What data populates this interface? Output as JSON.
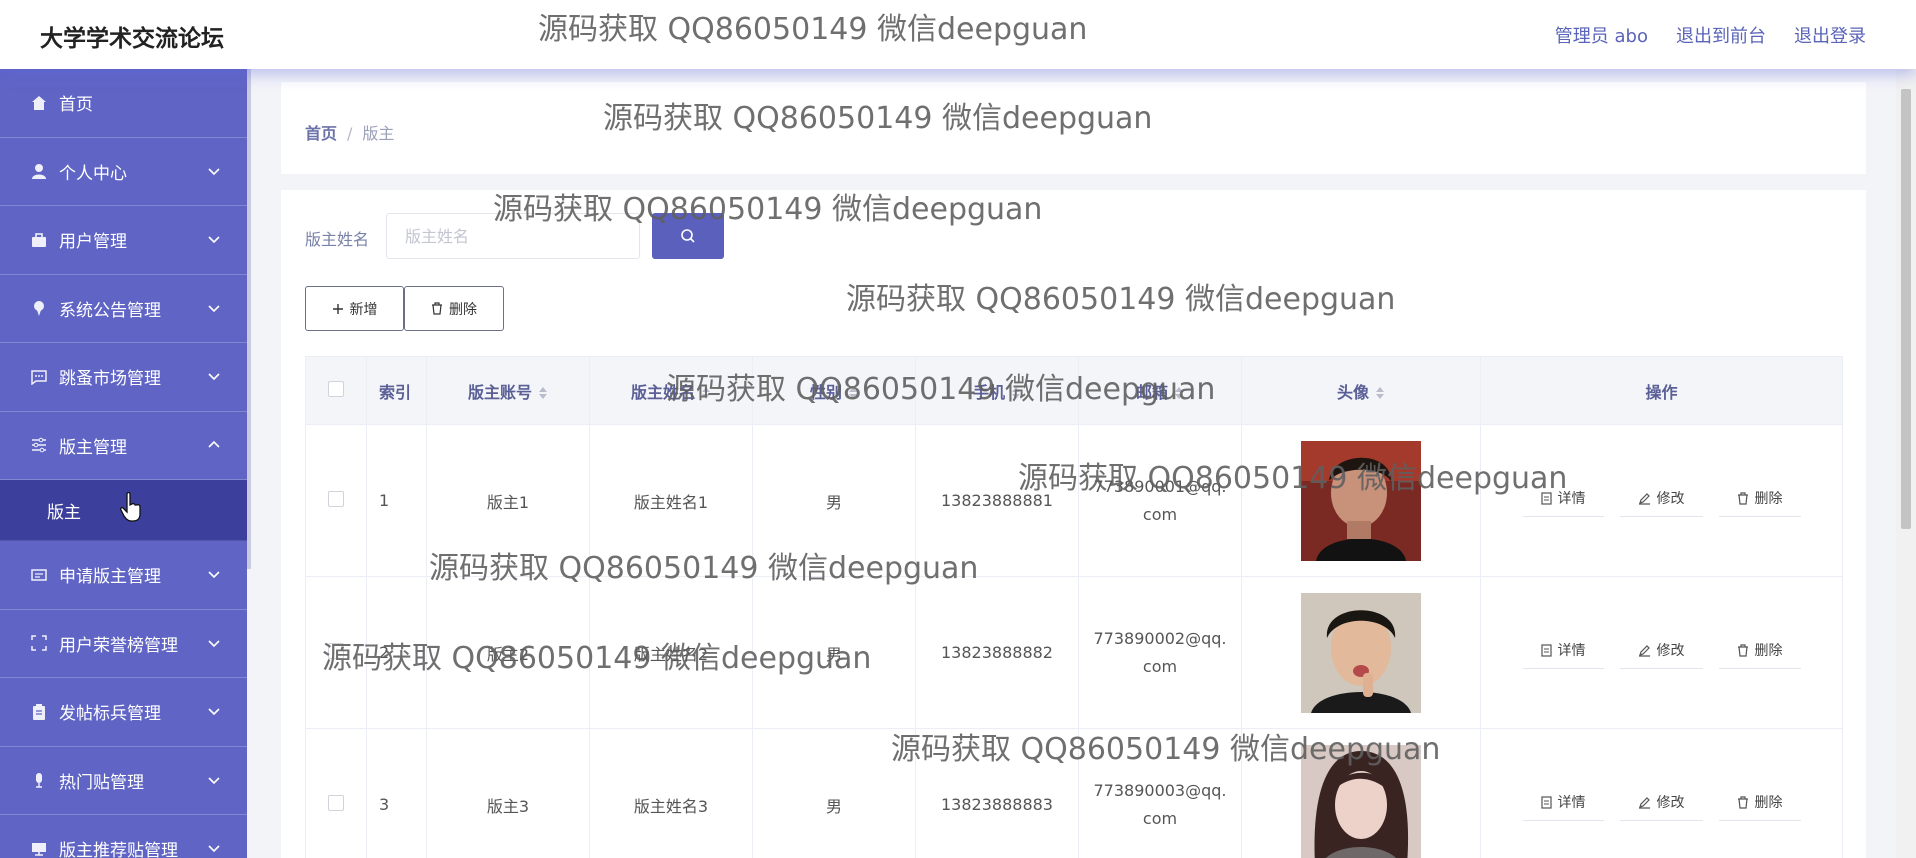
{
  "header": {
    "app_title": "大学学术交流论坛",
    "admin_label": "管理员 abo",
    "back_to_front": "退出到前台",
    "logout": "退出登录"
  },
  "sidebar": {
    "items": [
      {
        "label": "首页",
        "icon": "home-icon",
        "expandable": false
      },
      {
        "label": "个人中心",
        "icon": "user-icon",
        "expandable": true
      },
      {
        "label": "用户管理",
        "icon": "briefcase-icon",
        "expandable": true
      },
      {
        "label": "系统公告管理",
        "icon": "pin-icon",
        "expandable": true
      },
      {
        "label": "跳蚤市场管理",
        "icon": "chat-icon",
        "expandable": true
      },
      {
        "label": "版主管理",
        "icon": "sliders-icon",
        "expandable": true,
        "expanded": true
      },
      {
        "label": "申请版主管理",
        "icon": "card-icon",
        "expandable": true
      },
      {
        "label": "用户荣誉榜管理",
        "icon": "frame-icon",
        "expandable": true
      },
      {
        "label": "发帖标兵管理",
        "icon": "clipboard-icon",
        "expandable": true
      },
      {
        "label": "热门贴管理",
        "icon": "mic-icon",
        "expandable": true
      },
      {
        "label": "版主推荐贴管理",
        "icon": "monitor-icon",
        "expandable": true
      }
    ],
    "active_sub": "版主"
  },
  "breadcrumb": {
    "home": "首页",
    "current": "版主"
  },
  "search": {
    "label": "版主姓名",
    "placeholder": "版主姓名"
  },
  "toolbar": {
    "add_label": "新增",
    "delete_label": "删除"
  },
  "table": {
    "columns": [
      "索引",
      "版主账号",
      "版主姓名",
      "性别",
      "手机",
      "邮箱",
      "头像",
      "操作"
    ],
    "rows": [
      {
        "index": "1",
        "account": "版主1",
        "name": "版主姓名1",
        "gender": "男",
        "phone": "13823888881",
        "email_a": "773890001@qq.",
        "email_b": "com"
      },
      {
        "index": "2",
        "account": "版主2",
        "name": "版主姓名2",
        "gender": "男",
        "phone": "13823888882",
        "email_a": "773890002@qq.",
        "email_b": "com"
      },
      {
        "index": "3",
        "account": "版主3",
        "name": "版主姓名3",
        "gender": "男",
        "phone": "13823888883",
        "email_a": "773890003@qq.",
        "email_b": "com"
      }
    ],
    "op_labels": {
      "detail": "详情",
      "edit": "修改",
      "delete": "删除"
    }
  },
  "watermark": "源码获取 QQ86050149 微信deepguan",
  "colors": {
    "sidebar": "#6065c5",
    "sidebar_active": "#3c3f9c",
    "primary": "#5a60bb"
  }
}
